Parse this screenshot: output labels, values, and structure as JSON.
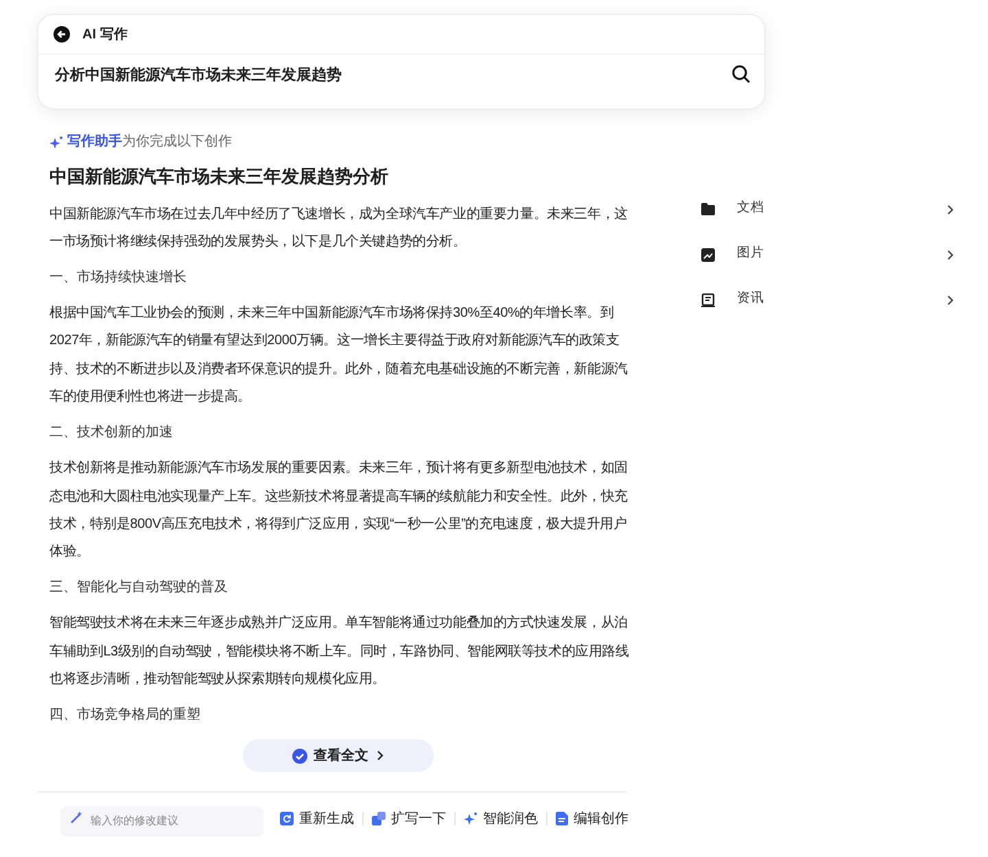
{
  "header": {
    "title": "AI 写作",
    "query": "分析中国新能源汽车市场未来三年发展趋势"
  },
  "assistant_note": "**写作助手**为你完成以下创作",
  "article": {
    "title": "中国新能源汽车市场未来三年发展趋势分析",
    "blocks": [
      {
        "kind": "paragraph",
        "text": "中国新能源汽车市场在过去几年中经历了飞速增长，成为全球汽车产业的重要力量。未来三年，这一市场预计将继续保持强劲的发展势头，以下是几个关键趋势的分析。"
      },
      {
        "kind": "heading",
        "text": "一、市场持续快速增长"
      },
      {
        "kind": "paragraph",
        "text": "根据中国汽车工业协会的预测，未来三年中国新能源汽车市场将保持30%至40%的年增长率。到2027年，新能源汽车的销量有望达到2000万辆。这一增长主要得益于政府对新能源汽车的政策支持、技术的不断进步以及消费者环保意识的提升。此外，随着充电基础设施的不断完善，新能源汽车的使用便利性也将进一步提高。"
      },
      {
        "kind": "heading",
        "text": "二、技术创新的加速"
      },
      {
        "kind": "paragraph",
        "text": "技术创新将是推动新能源汽车市场发展的重要因素。未来三年，预计将有更多新型电池技术，如固态电池和大圆柱电池实现量产上车。这些新技术将显著提高车辆的续航能力和安全性。此外，快充技术，特别是800V高压充电技术，将得到广泛应用，实现“一秒一公里”的充电速度，极大提升用户体验。"
      },
      {
        "kind": "heading",
        "text": "三、智能化与自动驾驶的普及"
      },
      {
        "kind": "paragraph",
        "text": "智能驾驶技术将在未来三年逐步成熟并广泛应用。单车智能将通过功能叠加的方式快速发展，从泊车辅助到L3级别的自动驾驶，智能模块将不断上车。同时，车路协同、智能网联等技术的应用路线也将逐步清晰，推动智能驾驶从探索期转向规模化应用。"
      },
      {
        "kind": "heading",
        "text": "四、市场竞争格局的重塑"
      }
    ]
  },
  "view_full_button": "查看全文",
  "suggestion_input": {
    "placeholder": "输入你的修改建议"
  },
  "actions": [
    {
      "kind": "regenerate",
      "label": "重新生成"
    },
    {
      "kind": "expand",
      "label": "扩写一下"
    },
    {
      "kind": "polish",
      "label": "智能润色"
    },
    {
      "kind": "edit",
      "label": "编辑创作"
    }
  ],
  "side_list": [
    {
      "kind": "docs",
      "label": "文档"
    },
    {
      "kind": "images",
      "label": "图片"
    },
    {
      "kind": "news",
      "label": "资讯"
    }
  ]
}
